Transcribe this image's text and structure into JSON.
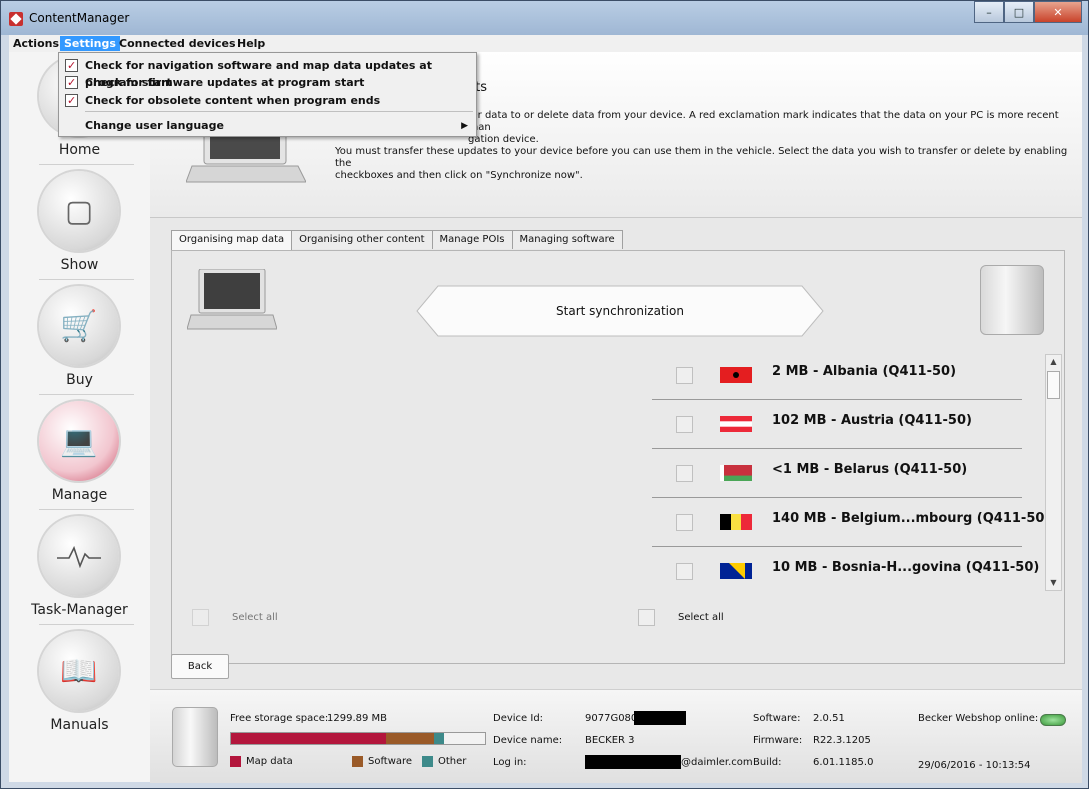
{
  "window": {
    "title": "ContentManager"
  },
  "menu": {
    "items": [
      "Actions",
      "Settings",
      "Connected devices",
      "Help"
    ],
    "active": "Settings"
  },
  "settings_menu": {
    "options": [
      {
        "label": "Check for navigation software and map data updates at program start",
        "checked": true
      },
      {
        "label": "Check for firmware updates at program start",
        "checked": true
      },
      {
        "label": "Check for obsolete content when program ends",
        "checked": true
      }
    ],
    "language": "Change user language"
  },
  "sidebar": {
    "items": [
      "Home",
      "Show",
      "Buy",
      "Manage",
      "Task-Manager",
      "Manuals"
    ],
    "active": "Manage"
  },
  "header": {
    "title_fragment": "cts",
    "line1": "fer data to or delete data from your device. A red exclamation mark indicates that the data on your PC is more recent than",
    "line2": "gation device.",
    "line3": "You must transfer these updates to your device before you can use them in the vehicle. Select the data you wish to transfer or delete by enabling the",
    "line4": "checkboxes and then click on \"Synchronize now\"."
  },
  "tabs": [
    "Organising map data",
    "Organising other content",
    "Manage POIs",
    "Managing software"
  ],
  "active_tab": "Organising map data",
  "sync": {
    "label": "Start synchronization"
  },
  "items": [
    {
      "label": "2 MB - Albania (Q411-50)",
      "flag": "albania-flag"
    },
    {
      "label": "102 MB - Austria (Q411-50)",
      "flag": "austria-flag"
    },
    {
      "label": "<1 MB - Belarus (Q411-50)",
      "flag": "belarus-flag"
    },
    {
      "label": "140 MB - Belgium...mbourg (Q411-50)",
      "flag": "belgium-flag"
    },
    {
      "label": "10 MB - Bosnia-H...govina (Q411-50)",
      "flag": "bosnia-flag"
    }
  ],
  "select_all_left": "Select all",
  "select_all_right": "Select all",
  "back": "Back",
  "footer": {
    "free_label": "Free storage space:",
    "free_value": "1299.89  MB",
    "legend": [
      "Map data",
      "Software",
      "Other"
    ],
    "usage": {
      "map": 0.61,
      "software": 0.19,
      "other": 0.04
    },
    "colors": {
      "map": "#b3163c",
      "software": "#9a5a28",
      "other": "#3d8a8a"
    },
    "device_id_label": "Device Id:",
    "device_id_value": "9077G080",
    "device_name_label": "Device name:",
    "device_name_value": "BECKER 3",
    "login_label": "Log in:",
    "login_value": "@daimler.com",
    "software_label": "Software:",
    "software_value": "2.0.51",
    "firmware_label": "Firmware:",
    "firmware_value": "R22.3.1205",
    "build_label": "Build:",
    "build_value": "6.01.1185.0",
    "webshop_label": "Becker Webshop online:",
    "datetime": "29/06/2016 - 10:13:54"
  }
}
